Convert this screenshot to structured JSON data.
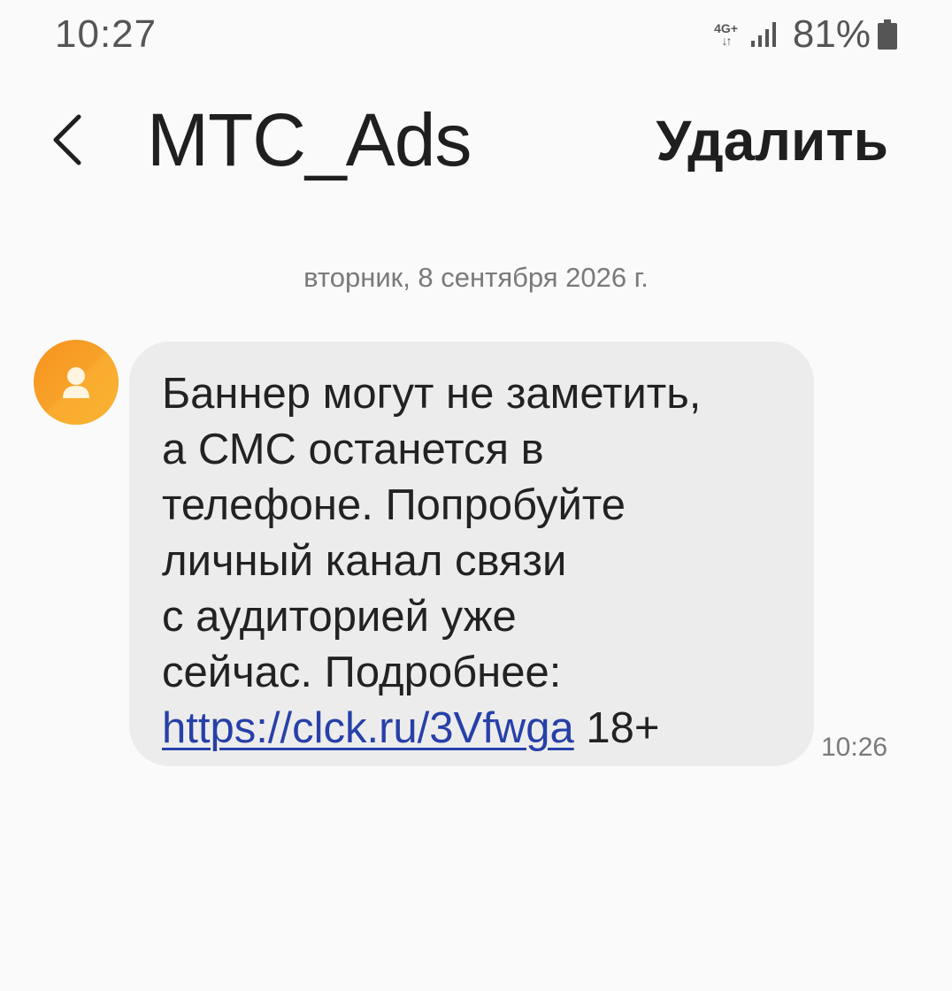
{
  "status_bar": {
    "time": "10:27",
    "network": "4G+",
    "battery_percent": "81%"
  },
  "header": {
    "title": "MTC_Ads",
    "delete_label": "Удалить",
    "back_icon": "chevron-left-icon"
  },
  "conversation": {
    "date_divider": "вторник, 8 сентября 2026 г.",
    "message": {
      "text": "Баннер могут не заметить,\nа СМС останется в\nтелефоне. Попробуйте\nличный канал связи\nс аудиторией уже\nсейчас. Подробнее:\n",
      "link": "https://clck.ru/3Vfwga",
      "suffix": " 18+",
      "time": "10:26"
    }
  },
  "colors": {
    "background": "#fafafa",
    "bubble": "#ececec",
    "link": "#2740a8",
    "avatar_gradient_start": "#f6921e",
    "avatar_gradient_end": "#f9b233"
  }
}
